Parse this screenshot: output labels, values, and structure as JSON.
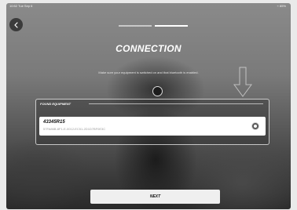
{
  "status_bar": {
    "left": "10:52  Tue Sep 6",
    "right": "⌁ 85%"
  },
  "back_button": {
    "icon": "chevron-left-icon"
  },
  "progress": {
    "steps": 2,
    "active_step": 2
  },
  "header": {
    "title": "CONNECTION",
    "subtitle": "Make sure your equipment is switched on and that bluetooth is enabled."
  },
  "found_equipment": {
    "label": "FOUND EQUIPMENT",
    "devices": [
      {
        "name": "43345R15",
        "id": "57FA86B-8F1-E-0012-EC51-2D1D7BF0E3C",
        "selected": true
      }
    ]
  },
  "actions": {
    "next_label": "NEXT"
  },
  "colors": {
    "accent": "#ffffff",
    "button_bg": "#efefef",
    "overlay": "#3a3a3a"
  }
}
